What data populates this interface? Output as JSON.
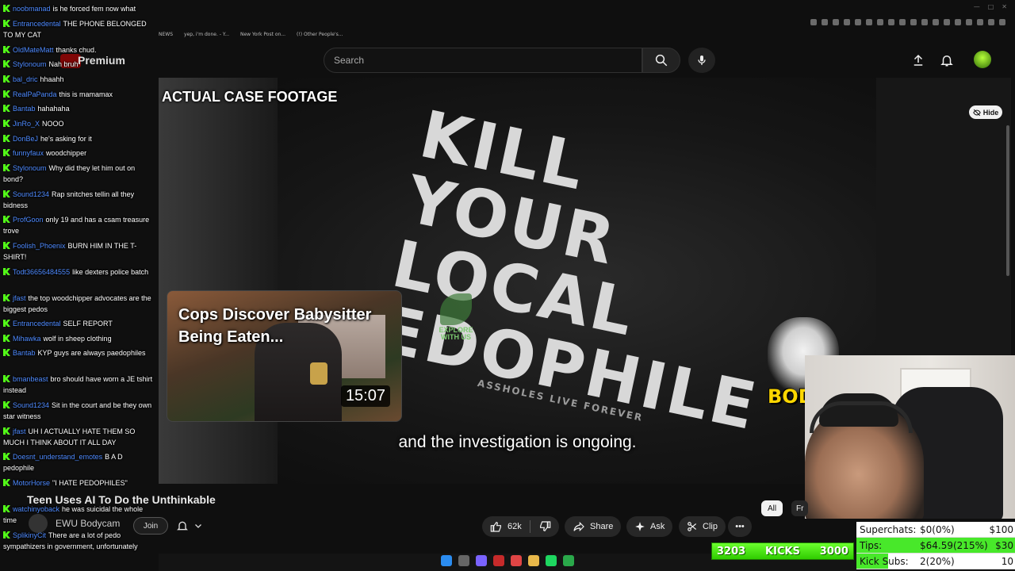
{
  "browser": {
    "bookmarks": [
      "NEWS",
      "yep, i'm done. - Y...",
      "New York Post on...",
      "(!) Other People's..."
    ]
  },
  "header": {
    "brand": "Premium",
    "search_placeholder": "Search"
  },
  "player": {
    "overlay_label": "ACTUAL CASE FOOTAGE",
    "shirt_lines": [
      "KILL",
      "YOUR",
      "LOCAL",
      "EDOPHILE"
    ],
    "shirt_tagline": "ASSHOLES LIVE FOREVER",
    "explore_logo": "EXPLORE WITH US",
    "subtitle": "and the investigation is ongoing.",
    "hide_label": "Hide",
    "endcard": {
      "title": "Cops Discover Babysitter Being Eaten...",
      "duration": "15:07"
    },
    "channel_logo_text": "BODY"
  },
  "video": {
    "title": "Teen Uses AI To Do the Unthinkable",
    "channel": "EWU Bodycam",
    "join_label": "Join",
    "likes": "62k",
    "share_label": "Share",
    "ask_label": "Ask",
    "clip_label": "Clip",
    "chips": [
      "All",
      "Fr"
    ]
  },
  "chat": [
    {
      "user": "noobmanad",
      "text": "is he forced fem now what",
      "color": "#4f8bff"
    },
    {
      "user": "Entrancedental",
      "text": "THE PHONE BELONGED TO MY CAT",
      "color": "#4f8bff"
    },
    {
      "user": "OldMateMatt",
      "text": "thanks chud.",
      "color": "#4f8bff"
    },
    {
      "user": "Stylonoum",
      "text": "Nah bruh",
      "color": "#4f8bff"
    },
    {
      "user": "bal_dric",
      "text": "hhaahh",
      "color": "#4f8bff"
    },
    {
      "user": "RealPaPanda",
      "text": "this is mamamax",
      "color": "#4f8bff"
    },
    {
      "user": "Bantab",
      "text": "hahahaha",
      "color": "#4f8bff"
    },
    {
      "user": "JinRo_X",
      "text": "NOOO",
      "color": "#4f8bff"
    },
    {
      "user": "DonBeJ",
      "text": "he's asking for it",
      "color": "#4f8bff"
    },
    {
      "user": "funnyfaux",
      "text": "woodchipper",
      "color": "#4f8bff"
    },
    {
      "user": "Stylonoum",
      "text": "Why did they let him out on bond?",
      "color": "#4f8bff"
    },
    {
      "user": "Sound1234",
      "text": "Rap snitches tellin all they bidness",
      "color": "#4f8bff"
    },
    {
      "user": "ProfGoon",
      "text": "only 19 and has a csam treasure trove",
      "color": "#4f8bff"
    },
    {
      "user": "Foolish_Phoenix",
      "text": "BURN HIM IN THE T-SHIRT!",
      "color": "#4f8bff"
    },
    {
      "user": "Todt36656484555",
      "text": "like dexters police batch",
      "color": "#4f8bff"
    },
    {
      "user": "jfast",
      "text": "the top woodchipper advocates are the biggest pedos",
      "color": "#4f8bff"
    },
    {
      "user": "Entrancedental",
      "text": "SELF REPORT",
      "color": "#4f8bff"
    },
    {
      "user": "Mihawka",
      "text": "wolf in sheep clothing",
      "color": "#4f8bff"
    },
    {
      "user": "Bantab",
      "text": "KYP guys are always paedophiles",
      "color": "#4f8bff"
    },
    {
      "user": "bmanbeast",
      "text": "bro should have worn a JE tshirt instead",
      "color": "#4f8bff"
    },
    {
      "user": "Sound1234",
      "text": "Sit in the court and be they own star witness",
      "color": "#4f8bff"
    },
    {
      "user": "jfast",
      "text": "UH I ACTUALLY HATE THEM SO MUCH I THINK ABOUT IT ALL DAY",
      "color": "#4f8bff"
    },
    {
      "user": "Doesnt_understand_emotes",
      "text": "B A D pedophile",
      "color": "#4f8bff"
    },
    {
      "user": "MotorHorse",
      "text": "\"I HATE PEDOPHILES\"",
      "color": "#4f8bff"
    },
    {
      "user": "watchinyoback",
      "text": "he was suicidal the whole time",
      "color": "#4f8bff"
    },
    {
      "user": "SplikinyCit",
      "text": "There are a lot of pedo sympathizers in government, unfortunately",
      "color": "#4f8bff"
    }
  ],
  "kicks": {
    "count": "3203",
    "label": "KICKS",
    "goal": "3000"
  },
  "goals": [
    {
      "label": "Superchats:",
      "value": "$0(0%)",
      "target": "$100",
      "fraction": 0.0
    },
    {
      "label": "Tips:",
      "value": "$64.59(215%)",
      "target": "$30",
      "fraction": 1.0
    },
    {
      "label": "Kick Subs:",
      "value": "2(20%)",
      "target": "10",
      "fraction": 0.2
    }
  ],
  "colors": {
    "kick_green": "#53fc18",
    "chat_user": "#4f8bff",
    "youtube_red": "#cc0000"
  }
}
